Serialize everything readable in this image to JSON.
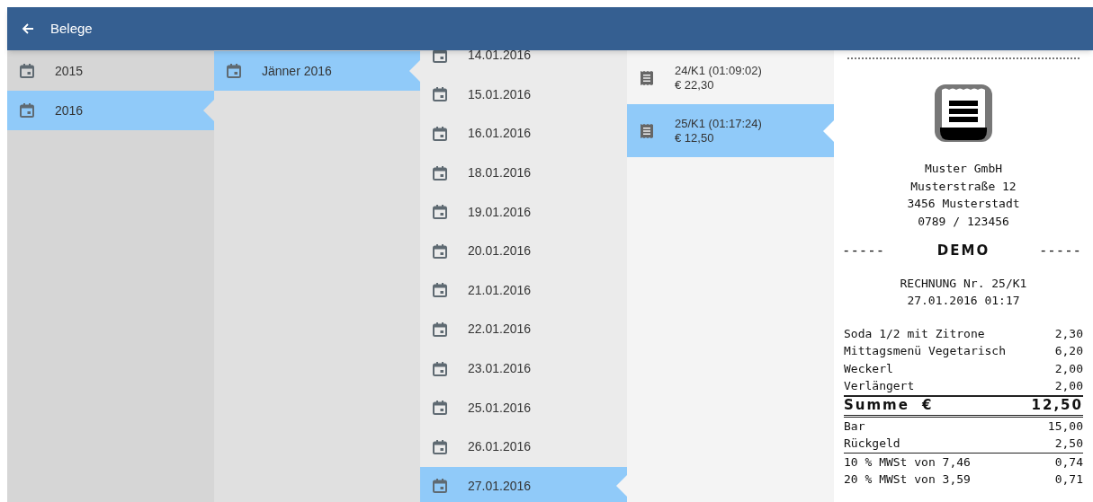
{
  "app_bar": {
    "title": "Belege"
  },
  "years": [
    {
      "label": "2015",
      "selected": false
    },
    {
      "label": "2016",
      "selected": true
    }
  ],
  "months": [
    {
      "label": "Jänner 2016",
      "selected": true
    }
  ],
  "days": [
    {
      "label": "14.01.2016",
      "selected": false
    },
    {
      "label": "15.01.2016",
      "selected": false
    },
    {
      "label": "16.01.2016",
      "selected": false
    },
    {
      "label": "18.01.2016",
      "selected": false
    },
    {
      "label": "19.01.2016",
      "selected": false
    },
    {
      "label": "20.01.2016",
      "selected": false
    },
    {
      "label": "21.01.2016",
      "selected": false
    },
    {
      "label": "22.01.2016",
      "selected": false
    },
    {
      "label": "23.01.2016",
      "selected": false
    },
    {
      "label": "25.01.2016",
      "selected": false
    },
    {
      "label": "26.01.2016",
      "selected": false
    },
    {
      "label": "27.01.2016",
      "selected": true
    }
  ],
  "receipts": [
    {
      "title": "24/K1 (01:09:02)",
      "amount": "€ 22,30",
      "selected": false
    },
    {
      "title": "25/K1 (01:17:24)",
      "amount": "€ 12,50",
      "selected": true
    }
  ],
  "receipt": {
    "company": [
      "Muster GmbH",
      "Musterstraße 12",
      "3456 Musterstadt",
      "0789 / 123456"
    ],
    "demo": {
      "dashes_left": "-----",
      "label": "DEMO",
      "dashes_right": "-----"
    },
    "heading": [
      "RECHNUNG Nr. 25/K1",
      "27.01.2016 01:17"
    ],
    "items": [
      {
        "name": "Soda 1/2 mit Zitrone",
        "price": "2,30"
      },
      {
        "name": "Mittagsmenü Vegetarisch",
        "price": "6,20"
      },
      {
        "name": "Weckerl",
        "price": "2,00"
      },
      {
        "name": "Verlängert",
        "price": "2,00"
      }
    ],
    "total": {
      "label": "Summe",
      "currency": "€",
      "amount": "12,50"
    },
    "payments": [
      {
        "name": "Bar",
        "amount": "15,00"
      },
      {
        "name": "Rückgeld",
        "amount": "2,50"
      }
    ],
    "taxes": [
      {
        "name": "10 % MWSt von 7,46",
        "amount": "0,74"
      },
      {
        "name": "20 % MWSt von 3,59",
        "amount": "0,71"
      }
    ]
  }
}
